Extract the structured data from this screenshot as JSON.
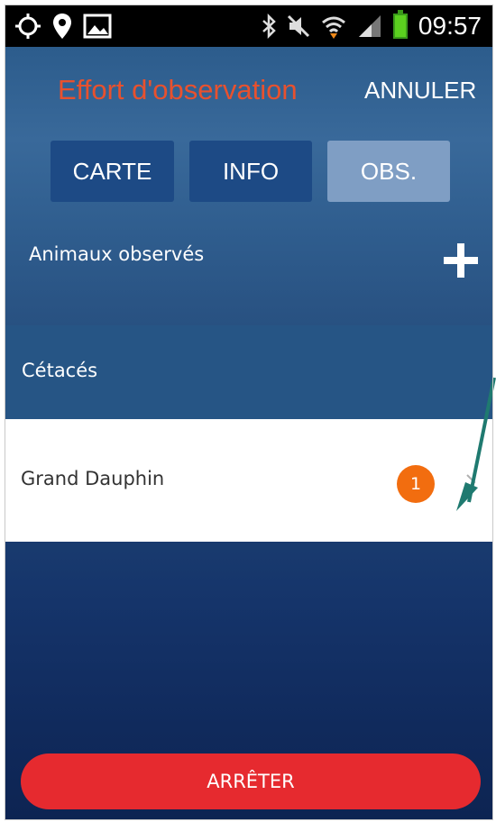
{
  "status_bar": {
    "time": "09:57",
    "icons": [
      "gps-icon",
      "location-pin-icon",
      "image-icon",
      "bluetooth-icon",
      "mute-icon",
      "wifi-icon",
      "signal-icon",
      "battery-icon"
    ]
  },
  "header": {
    "title": "Effort d'observation",
    "cancel_label": "ANNULER",
    "title_color": "#e8512e"
  },
  "tabs": [
    {
      "label": "CARTE",
      "active": false
    },
    {
      "label": "INFO",
      "active": false
    },
    {
      "label": "OBS.",
      "active": true
    }
  ],
  "observed": {
    "label": "Animaux observés",
    "add_icon": "plus-icon"
  },
  "category": {
    "label": "Cétacés"
  },
  "list": [
    {
      "label": "Grand Dauphin",
      "count": "1",
      "badge_color": "#f26d0f"
    }
  ],
  "stop_button": {
    "label": "ARRÊTER",
    "color": "#e62a2f"
  }
}
